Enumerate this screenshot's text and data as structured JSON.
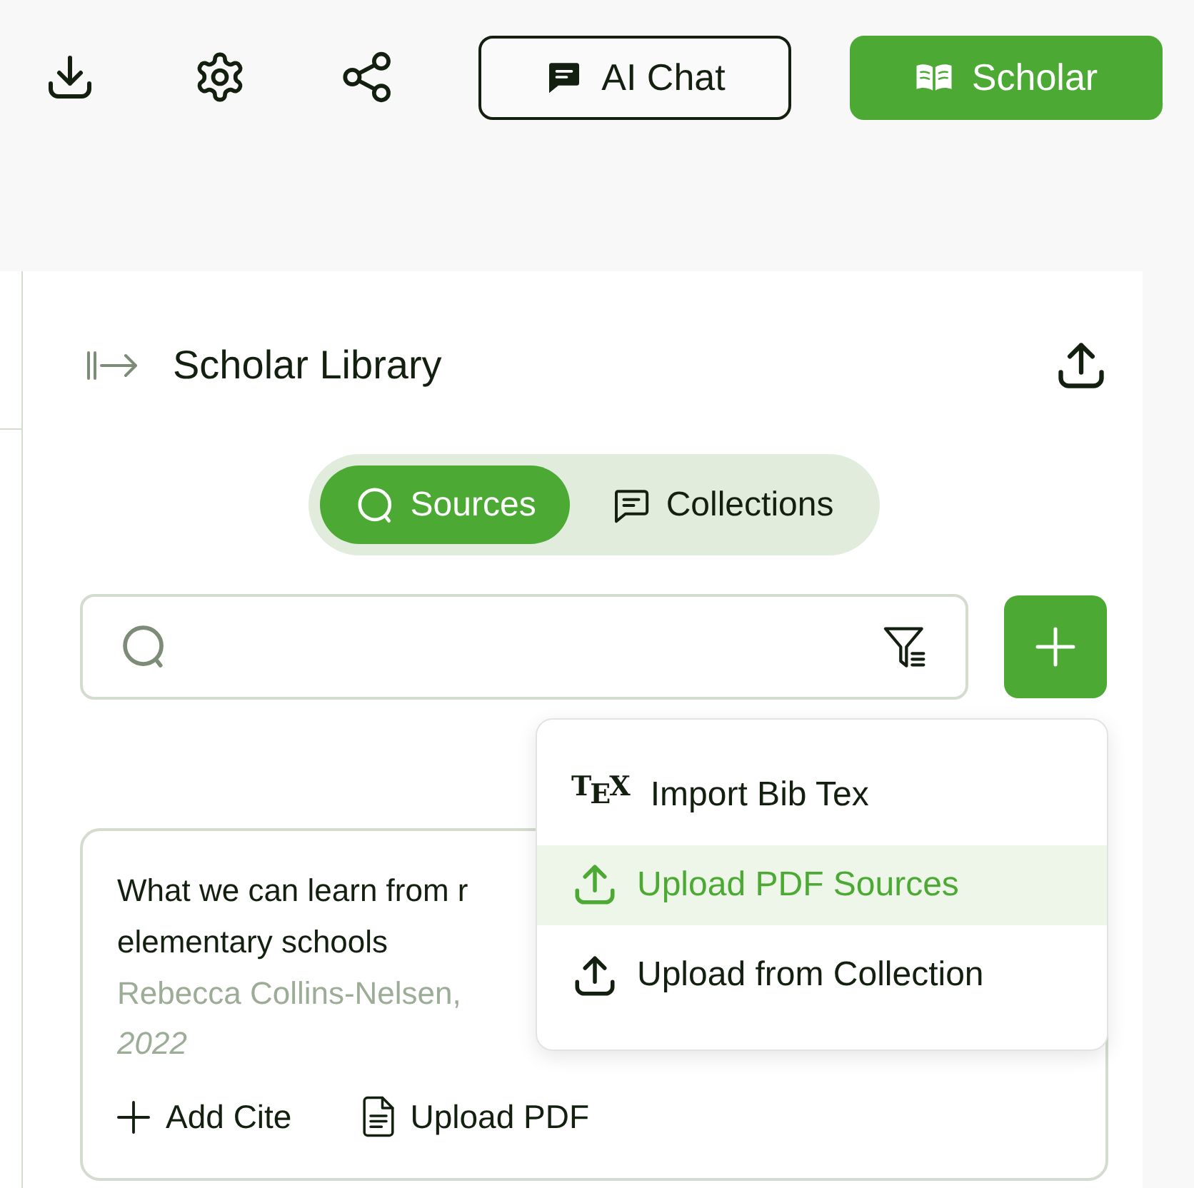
{
  "toolbar": {
    "buttons": [
      {
        "label": "AI Chat",
        "kind": "chat",
        "selected": false
      },
      {
        "label": "Scholar",
        "kind": "scholar",
        "selected": true
      }
    ]
  },
  "library": {
    "title": "Scholar Library",
    "tabs": [
      {
        "label": "Sources",
        "kind": "sources",
        "selected": true
      },
      {
        "label": "Collections",
        "kind": "collections",
        "selected": false
      }
    ],
    "card": {
      "title_lines": [
        "What we can learn from r",
        "elementary schools"
      ],
      "authors": "Rebecca Collins-Nelsen,",
      "year": "2022",
      "actions": [
        {
          "label": "Add Cite",
          "kind": "cite"
        },
        {
          "label": "Upload PDF",
          "kind": "pdf"
        }
      ]
    },
    "add_menu": {
      "items": [
        {
          "label": "Import Bib Tex",
          "kind": "tex",
          "logo": "T$_{E}$X",
          "selected": false
        },
        {
          "label": "Upload PDF Sources",
          "kind": "upload",
          "selected": true
        },
        {
          "label": "Upload from Collection",
          "kind": "upload",
          "selected": false
        }
      ]
    }
  }
}
